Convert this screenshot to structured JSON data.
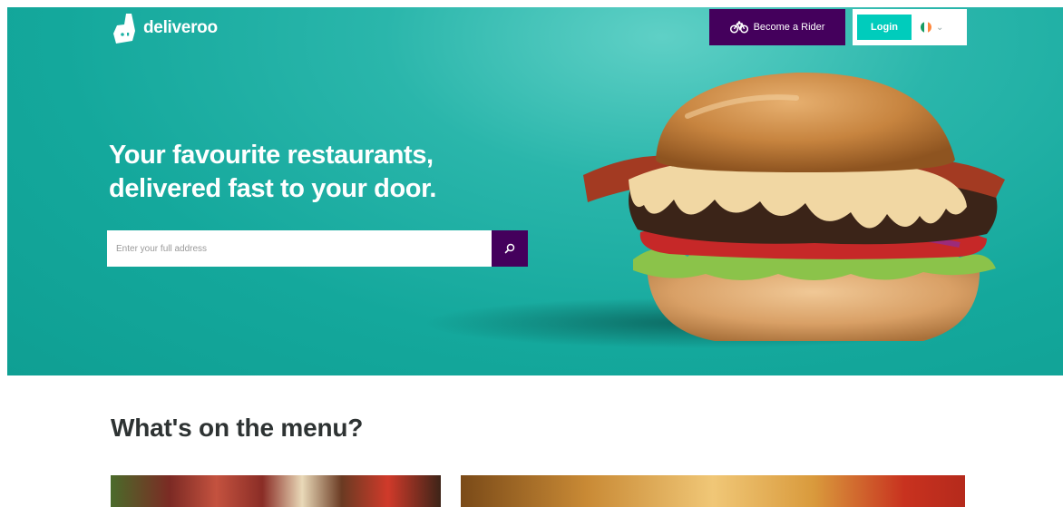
{
  "header": {
    "logo_text": "deliveroo",
    "rider_button_label": "Become a Rider",
    "login_label": "Login",
    "country_flag_colors": [
      "#169b62",
      "#ffffff",
      "#ff883e"
    ]
  },
  "hero": {
    "headline_line1": "Your favourite restaurants,",
    "headline_line2": "delivered fast to your door.",
    "search_placeholder": "Enter your full address",
    "background_color": "#14a89c"
  },
  "brand": {
    "teal": "#00ccbc",
    "purple": "#44005c"
  },
  "menu_section": {
    "title": "What's on the menu?"
  }
}
